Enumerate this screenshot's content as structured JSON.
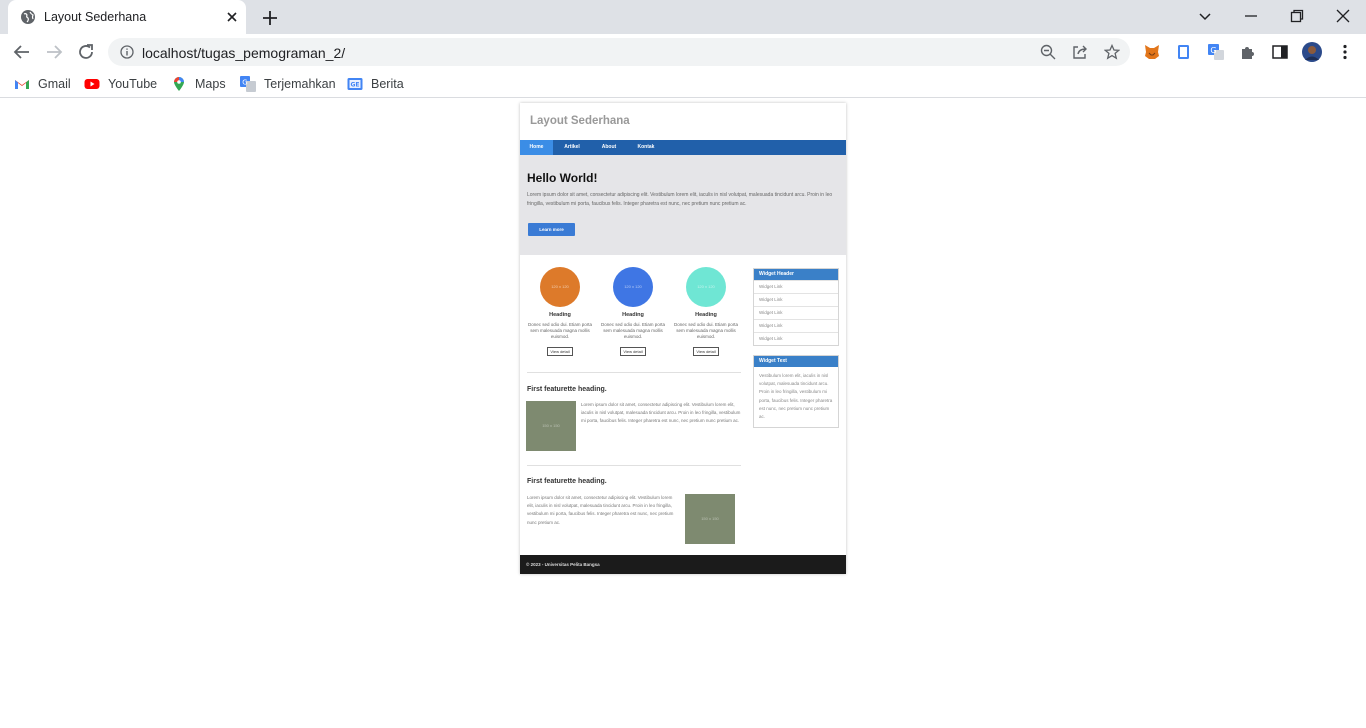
{
  "browser": {
    "tab_title": "Layout Sederhana",
    "url": "localhost/tugas_pemograman_2/",
    "bookmarks": [
      {
        "label": "Gmail",
        "icon": "gmail-icon"
      },
      {
        "label": "YouTube",
        "icon": "youtube-icon"
      },
      {
        "label": "Maps",
        "icon": "maps-icon"
      },
      {
        "label": "Terjemahkan",
        "icon": "translate-icon"
      },
      {
        "label": "Berita",
        "icon": "news-icon"
      }
    ]
  },
  "site": {
    "title": "Layout Sederhana",
    "nav": [
      "Home",
      "Artikel",
      "About",
      "Kontak"
    ],
    "hero": {
      "heading": "Hello World!",
      "text": "Lorem ipsum dolor sit amet, consectetur adipiscing elit. Vestibulum lorem elit, iaculis in nisl volutpat, malesuada tincidunt arcu. Proin in leo fringilla, vestibulum mi porta, faucibus felis. Integer pharetra est nunc, nec pretium nunc pretium ac.",
      "button": "Learn more"
    },
    "columns": [
      {
        "img": "120 x 120",
        "heading": "Heading",
        "text": "Donec sed odio dui. Etiam porta sem malesuada magna mollis euismod.",
        "button": "View detail",
        "color": "#dd7a2a"
      },
      {
        "img": "120 x 120",
        "heading": "Heading",
        "text": "Donec sed odio dui. Etiam porta sem malesuada magna mollis euismod.",
        "button": "View detail",
        "color": "#3f76e4"
      },
      {
        "img": "120 x 120",
        "heading": "Heading",
        "text": "Donec sed odio dui. Etiam porta sem malesuada magna mollis euismod.",
        "button": "View detail",
        "color": "#6fe6d4"
      }
    ],
    "featurettes": [
      {
        "heading": "First featurette heading.",
        "img": "150 x 150",
        "text": "Lorem ipsum dolor sit amet, consectetur adipiscing elit. Vestibulum lorem elit, iaculis in nisl volutpat, malesuada tincidunt arcu. Proin in leo fringilla, vestibulum mi porta, faucibus felis. Integer pharetra est nunc, nec pretium nunc pretium ac."
      },
      {
        "heading": "First featurette heading.",
        "img": "150 x 150",
        "text": "Lorem ipsum dolor sit amet, consectetur adipiscing elit. Vestibulum lorem elit, iaculis in nisl volutpat, malesuada tincidunt arcu. Proin in leo fringilla, vestibulum mi porta, faucibus felis. Integer pharetra est nunc, nec pretium nunc pretium ac."
      }
    ],
    "widget_links": {
      "header": "Widget Header",
      "links": [
        "Widget Link",
        "Widget Link",
        "Widget Link",
        "Widget Link",
        "Widget Link"
      ]
    },
    "widget_text": {
      "header": "Widget Text",
      "text": "Vestibulum lorem elit, iaculis in nisl volutpat, malesuada tincidunt arcu. Proin in leo fringilla, vestibulum mi porta, faucibus felis. Integer pharetra est nunc, nec pretium nunc pretium ac."
    },
    "footer": "© 2023 - Universitas Pelita Bangsa"
  },
  "colors": {
    "nav_bg": "#2160aa",
    "nav_active": "#3b8de6",
    "hero_bg": "#e5e5e8",
    "button_blue": "#3a7bd5",
    "widget_header": "#3a80c8",
    "footer_bg": "#1b1b1b",
    "placeholder_img": "#7e8a70"
  }
}
